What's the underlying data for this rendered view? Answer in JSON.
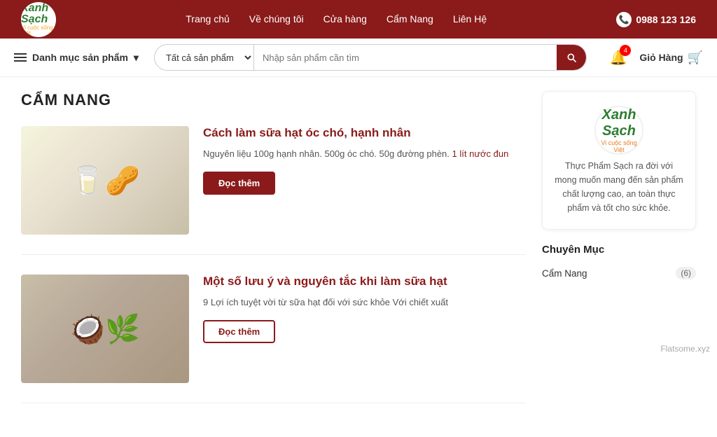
{
  "site": {
    "brand_name": "Xanh Sạch",
    "brand_tagline": "Vi cuộc sống Việt",
    "phone": "0988 123 126"
  },
  "top_nav": {
    "links": [
      {
        "label": "Trang chủ",
        "href": "#"
      },
      {
        "label": "Về chúng tôi",
        "href": "#"
      },
      {
        "label": "Cửa hàng",
        "href": "#"
      },
      {
        "label": "Cẩm Nang",
        "href": "#"
      },
      {
        "label": "Liên Hệ",
        "href": "#"
      }
    ]
  },
  "sec_nav": {
    "category_menu_label": "Danh mục sản phẩm",
    "search_placeholder": "Nhập sản phẩm cần tìm",
    "category_option": "Tất cả sản phẩm",
    "cart_label": "Giỏ Hàng",
    "bell_count": "4"
  },
  "page": {
    "title": "CẨM NANG"
  },
  "articles": [
    {
      "id": 1,
      "title": "Cách làm sữa hạt óc chó, hạnh nhân",
      "excerpt": "Nguyên liệu 100g hạnh nhân. 500g óc chó. 50g đường phèn.",
      "excerpt_link": "1 lít nước đun",
      "read_more": "Đọc thêm",
      "style": "filled"
    },
    {
      "id": 2,
      "title": "Một số lưu ý và nguyên tắc khi làm sữa hạt",
      "excerpt": "9 Lợi ích tuyệt vời từ sữa hạt đối với sức khỏe Với chiết xuất",
      "read_more": "Đọc thêm",
      "style": "outline"
    }
  ],
  "sidebar": {
    "desc": "Thực Phẩm Sạch ra đời với mong muốn mang đến sản phẩm chất lượng cao, an toàn thực phẩm và tốt cho sức khỏe.",
    "section_title": "Chuyên Mục",
    "categories": [
      {
        "label": "Cẩm Nang",
        "count": "(6)"
      }
    ]
  },
  "watermark": "Flatsome.xyz"
}
